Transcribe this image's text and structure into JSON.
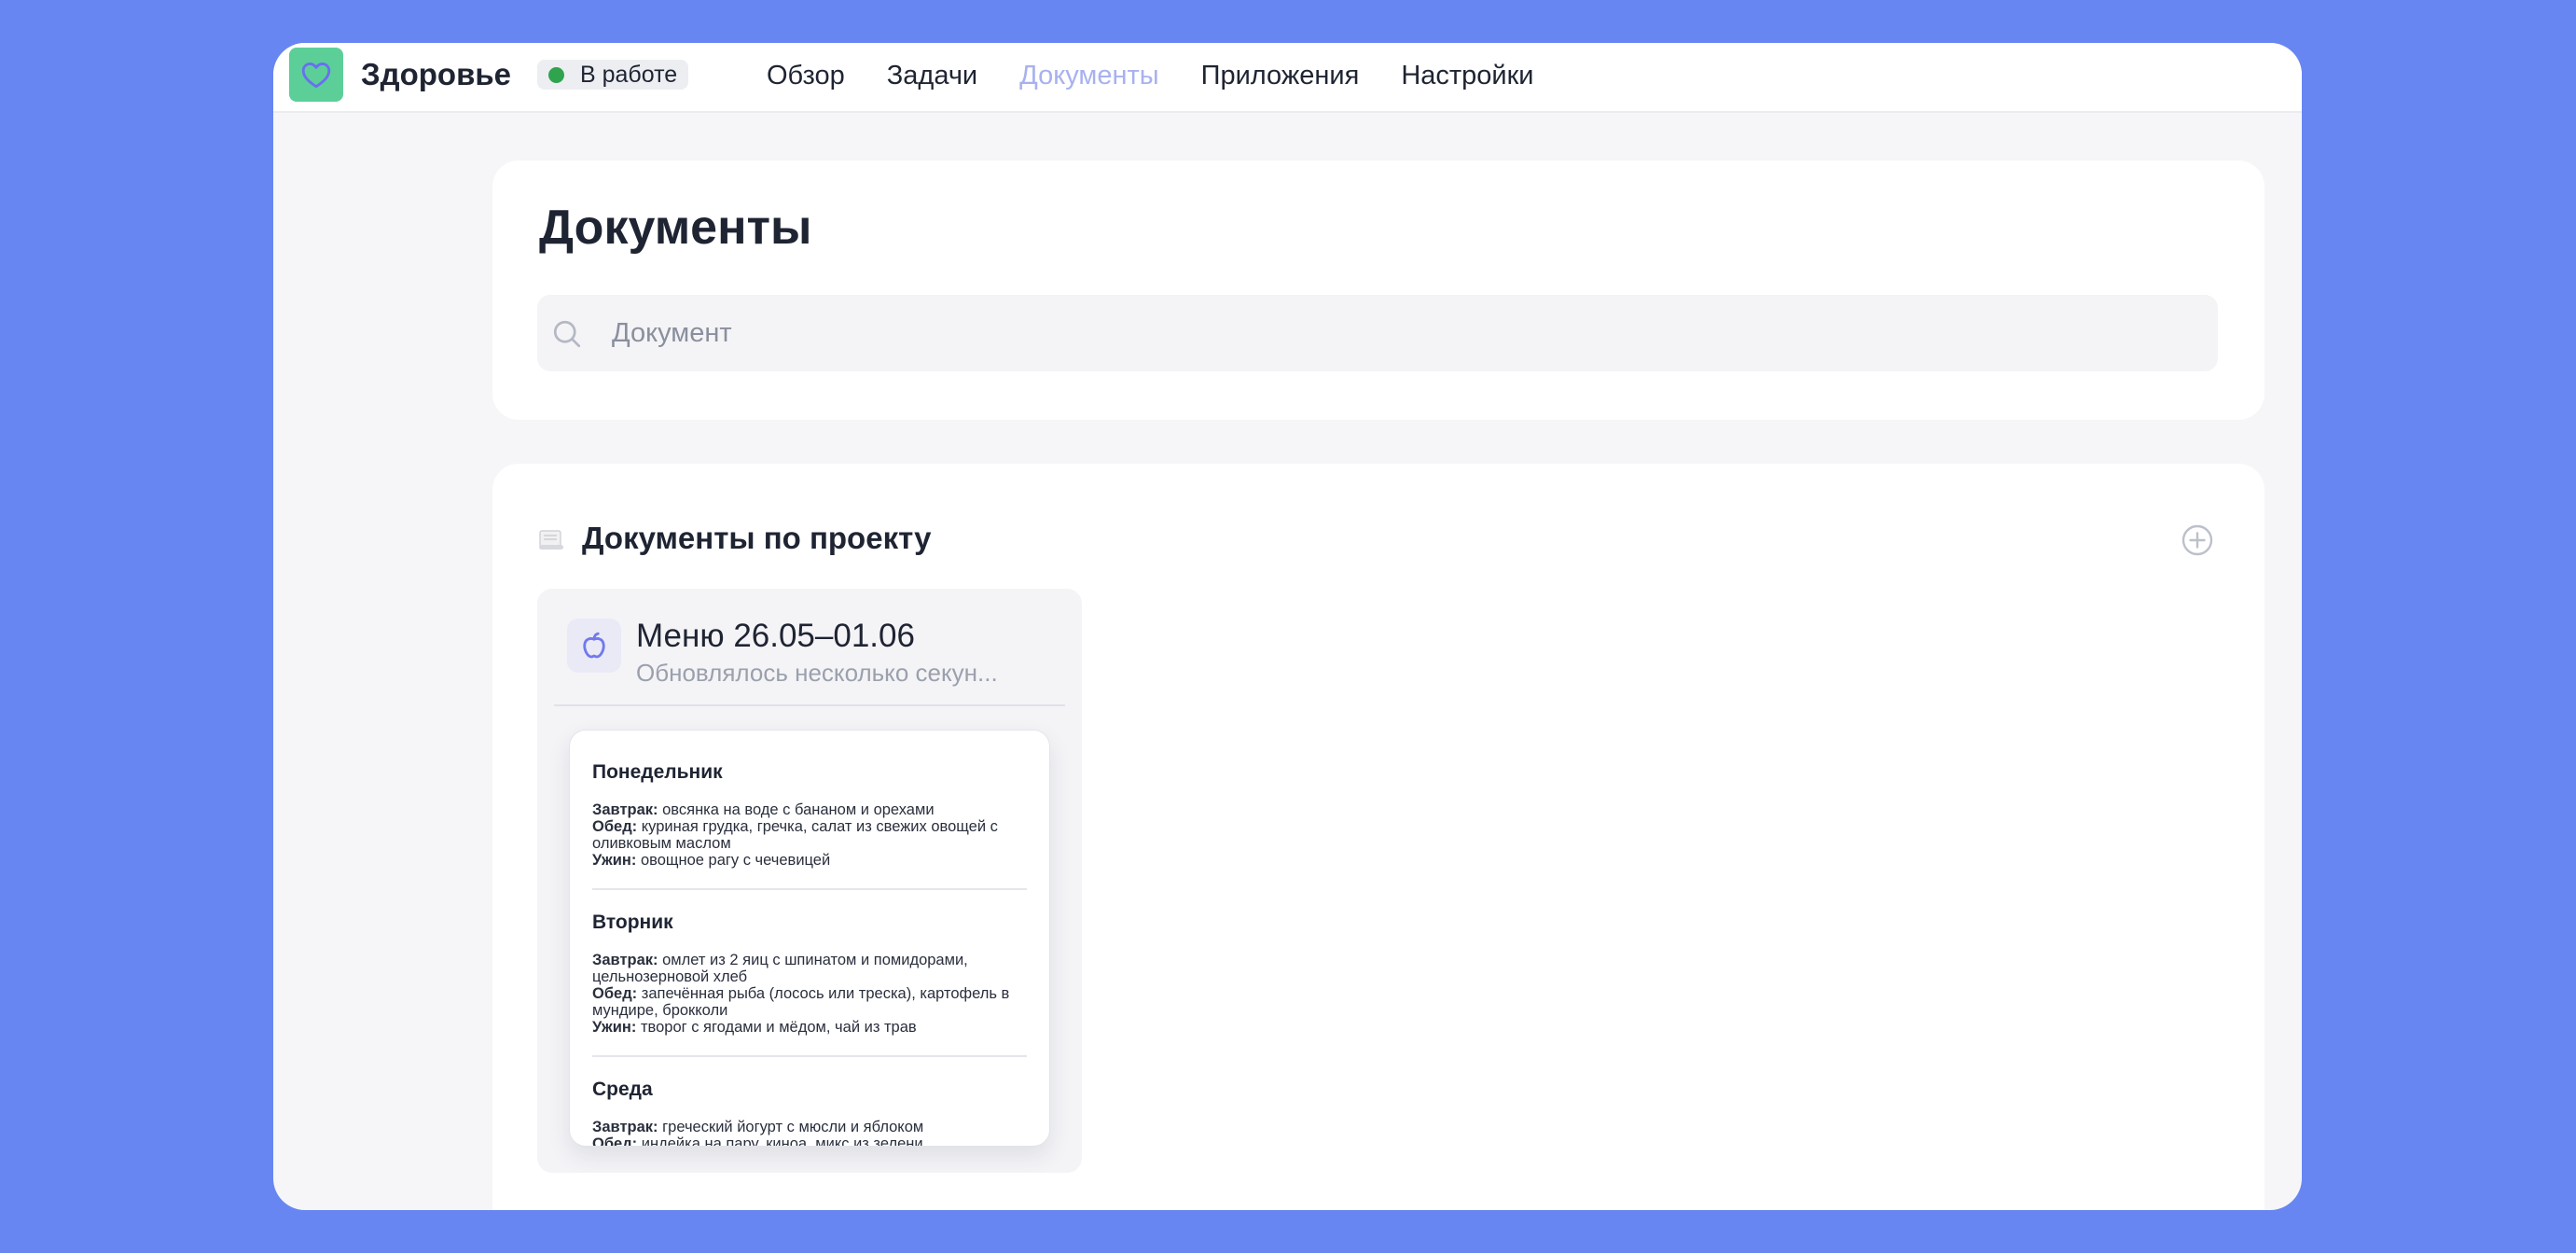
{
  "app": {
    "name": "Здоровье",
    "status": "В работе",
    "accent_color": "#5ccf99",
    "status_color": "#30a34f"
  },
  "nav": {
    "items": [
      {
        "label": "Обзор",
        "active": false
      },
      {
        "label": "Задачи",
        "active": false
      },
      {
        "label": "Документы",
        "active": true
      },
      {
        "label": "Приложения",
        "active": false
      },
      {
        "label": "Настройки",
        "active": false
      }
    ]
  },
  "page": {
    "title": "Документы",
    "search": {
      "placeholder": "Документ",
      "value": ""
    }
  },
  "section": {
    "icon": "scroll-icon",
    "title": "Документы по проекту",
    "add_icon": "add-circle-icon"
  },
  "document": {
    "icon": "apple-icon",
    "title": "Меню 26.05–01.06",
    "subtitle": "Обновлялось несколько секун...",
    "preview": {
      "days": [
        {
          "name": "Понедельник",
          "meals": [
            {
              "label": "Завтрак:",
              "text": "овсянка на воде с бананом и орехами"
            },
            {
              "label": "Обед:",
              "text": "куриная грудка, гречка, салат из свежих овощей с оливковым маслом"
            },
            {
              "label": "Ужин:",
              "text": "овощное рагу с чечевицей"
            }
          ]
        },
        {
          "name": "Вторник",
          "meals": [
            {
              "label": "Завтрак:",
              "text": "омлет из 2 яиц с шпинатом и помидорами, цельнозерновой хлеб"
            },
            {
              "label": "Обед:",
              "text": "запечённая рыба (лосось или треска), картофель в мундире, брокколи"
            },
            {
              "label": "Ужин:",
              "text": "творог с ягодами и мёдом, чай из трав"
            }
          ]
        },
        {
          "name": "Среда",
          "meals": [
            {
              "label": "Завтрак:",
              "text": "греческий йогурт с мюсли и яблоком"
            },
            {
              "label": "Обед:",
              "text": "индейка на пару, киноа, микс из зелени"
            }
          ]
        }
      ]
    }
  }
}
